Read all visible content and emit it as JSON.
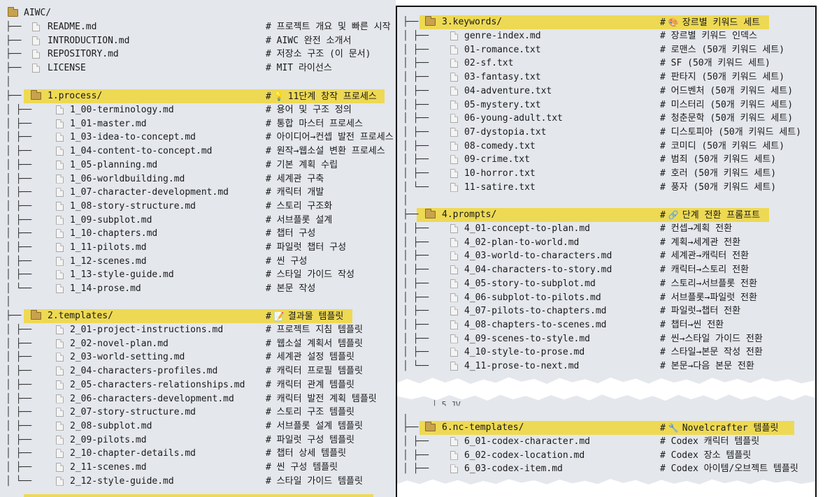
{
  "left": {
    "root": "AIWC/",
    "top_files": [
      {
        "name": "README.md",
        "comment": "프로젝트 개요 및 빠른 시작"
      },
      {
        "name": "INTRODUCTION.md",
        "comment": "AIWC 완전 소개서"
      },
      {
        "name": "REPOSITORY.md",
        "comment": "저장소 구조 (이 문서)"
      },
      {
        "name": "LICENSE",
        "comment": "MIT 라이선스"
      }
    ],
    "process": {
      "folder": "1.process/",
      "comment": "11단계 창작 프로세스",
      "icon": "lightbulb-icon",
      "files": [
        {
          "name": "1_00-terminology.md",
          "comment": "용어 및 구조 정의"
        },
        {
          "name": "1_01-master.md",
          "comment": "통합 마스터 프로세스"
        },
        {
          "name": "1_03-idea-to-concept.md",
          "comment": "아이디어→컨셉 발전 프로세스"
        },
        {
          "name": "1_04-content-to-concept.md",
          "comment": "원작→웹소설 변환 프로세스"
        },
        {
          "name": "1_05-planning.md",
          "comment": "기본 계획 수립"
        },
        {
          "name": "1_06-worldbuilding.md",
          "comment": "세계관 구축"
        },
        {
          "name": "1_07-character-development.md",
          "comment": "캐릭터 개발"
        },
        {
          "name": "1_08-story-structure.md",
          "comment": "스토리 구조화"
        },
        {
          "name": "1_09-subplot.md",
          "comment": "서브플롯 설계"
        },
        {
          "name": "1_10-chapters.md",
          "comment": "챕터 구성"
        },
        {
          "name": "1_11-pilots.md",
          "comment": "파일럿 챕터 구성"
        },
        {
          "name": "1_12-scenes.md",
          "comment": "씬 구성"
        },
        {
          "name": "1_13-style-guide.md",
          "comment": "스타일 가이드 작성"
        },
        {
          "name": "1_14-prose.md",
          "comment": "본문 작성"
        }
      ]
    },
    "templates": {
      "folder": "2.templates/",
      "comment": "결과물 템플릿",
      "icon": "memo-icon",
      "files": [
        {
          "name": "2_01-project-instructions.md",
          "comment": "프로젝트 지침 템플릿"
        },
        {
          "name": "2_02-novel-plan.md",
          "comment": "웹소설 계획서 템플릿"
        },
        {
          "name": "2_03-world-setting.md",
          "comment": "세계관 설정 템플릿"
        },
        {
          "name": "2_04-characters-profiles.md",
          "comment": "캐릭터 프로필 템플릿"
        },
        {
          "name": "2_05-characters-relationships.md",
          "comment": "캐릭터 관계 템플릿"
        },
        {
          "name": "2_06-characters-development.md",
          "comment": "캐릭터 발전 계획 템플릿"
        },
        {
          "name": "2_07-story-structure.md",
          "comment": "스토리 구조 템플릿"
        },
        {
          "name": "2_08-subplot.md",
          "comment": "서브플롯 설계 템플릿"
        },
        {
          "name": "2_09-pilots.md",
          "comment": "파일럿 구성 템플릿"
        },
        {
          "name": "2_10-chapter-details.md",
          "comment": "챕터 상세 템플릿"
        },
        {
          "name": "2_11-scenes.md",
          "comment": "씬 구성 템플릿"
        },
        {
          "name": "2_12-style-guide.md",
          "comment": "스타일 가이드 템플릿"
        }
      ]
    }
  },
  "right": {
    "keywords": {
      "folder": "3.keywords/",
      "comment": "장르별 키워드 세트",
      "icon": "palette-icon",
      "files": [
        {
          "name": "genre-index.md",
          "comment": "장르별 키워드 인덱스"
        },
        {
          "name": "01-romance.txt",
          "comment": "로맨스 (50개 키워드 세트)"
        },
        {
          "name": "02-sf.txt",
          "comment": "SF (50개 키워드 세트)"
        },
        {
          "name": "03-fantasy.txt",
          "comment": "판타지 (50개 키워드 세트)"
        },
        {
          "name": "04-adventure.txt",
          "comment": "어드벤처 (50개 키워드 세트)"
        },
        {
          "name": "05-mystery.txt",
          "comment": "미스터리 (50개 키워드 세트)"
        },
        {
          "name": "06-young-adult.txt",
          "comment": "청춘문학 (50개 키워드 세트)"
        },
        {
          "name": "07-dystopia.txt",
          "comment": "디스토피아 (50개 키워드 세트)"
        },
        {
          "name": "08-comedy.txt",
          "comment": "코미디 (50개 키워드 세트)"
        },
        {
          "name": "09-crime.txt",
          "comment": "범죄 (50개 키워드 세트)"
        },
        {
          "name": "10-horror.txt",
          "comment": "호러 (50개 키워드 세트)"
        },
        {
          "name": "11-satire.txt",
          "comment": "풍자 (50개 키워드 세트)"
        }
      ]
    },
    "prompts": {
      "folder": "4.prompts/",
      "comment": "단계 전환 프롬프트",
      "icon": "link-icon",
      "files": [
        {
          "name": "4_01-concept-to-plan.md",
          "comment": "컨셉→계획 전환"
        },
        {
          "name": "4_02-plan-to-world.md",
          "comment": "계획→세계관 전환"
        },
        {
          "name": "4_03-world-to-characters.md",
          "comment": "세계관→캐릭터 전환"
        },
        {
          "name": "4_04-characters-to-story.md",
          "comment": "캐릭터→스토리 전환"
        },
        {
          "name": "4_05-story-to-subplot.md",
          "comment": "스토리→서브플롯 전환"
        },
        {
          "name": "4_06-subplot-to-pilots.md",
          "comment": "서브플롯→파일럿 전환"
        },
        {
          "name": "4_07-pilots-to-chapters.md",
          "comment": "파일럿→챕터 전환"
        },
        {
          "name": "4_08-chapters-to-scenes.md",
          "comment": "챕터→씬 전환"
        },
        {
          "name": "4_09-scenes-to-style.md",
          "comment": "씬→스타일 가이드 전환"
        },
        {
          "name": "4_10-style-to-prose.md",
          "comment": "스타일→본문 작성 전환"
        },
        {
          "name": "4_11-prose-to-next.md",
          "comment": "본문→다음 본문 전환"
        }
      ]
    },
    "nc_templates": {
      "folder": "6.nc-templates/",
      "comment": "Novelcrafter 템플릿",
      "icon": "wrench-icon",
      "files": [
        {
          "name": "6_01-codex-character.md",
          "comment": "Codex 캐릭터 템플릿"
        },
        {
          "name": "6_02-codex-location.md",
          "comment": "Codex 장소 템플릿"
        },
        {
          "name": "6_03-codex-item.md",
          "comment": "Codex 아이템/오브젝트 템플릿"
        }
      ]
    }
  },
  "colors": {
    "panel_bg": "#e4e7ec",
    "highlight": "#eed954",
    "border": "#111111"
  }
}
